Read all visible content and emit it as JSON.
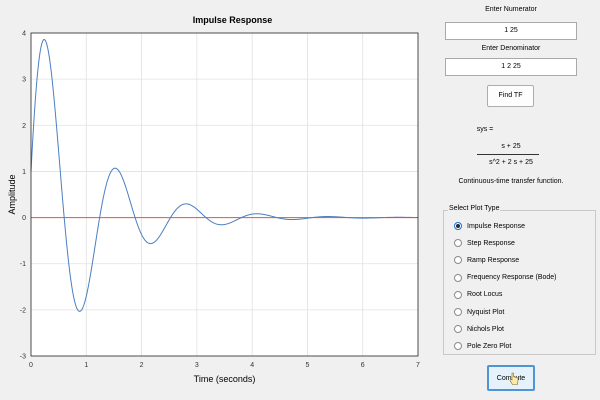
{
  "controls": {
    "numerator_label": "Enter Numerator",
    "numerator_value": "1 25",
    "denominator_label": "Enter Denominator",
    "denominator_value": "1 2 25",
    "find_tf_label": "Find TF",
    "compute_label": "Compute"
  },
  "tf_display": {
    "sys_label": "sys =",
    "numerator": "s + 25",
    "denominator": "s^2 + 2 s + 25",
    "description": "Continuous-time transfer function."
  },
  "plot_type": {
    "title": "Select Plot Type",
    "selected_index": 0,
    "options": [
      {
        "label": "Impulse Response"
      },
      {
        "label": "Step Response"
      },
      {
        "label": "Ramp Response"
      },
      {
        "label": "Frequency Response (Bode)"
      },
      {
        "label": "Root Locus"
      },
      {
        "label": "Nyquist Plot"
      },
      {
        "label": "Nichols Plot"
      },
      {
        "label": "Pole Zero Plot"
      }
    ]
  },
  "chart_data": {
    "type": "line",
    "title": "Impulse Response",
    "xlabel": "Time (seconds)",
    "ylabel": "Amplitude",
    "xlim": [
      0,
      7
    ],
    "ylim": [
      -3,
      4
    ],
    "xticks": [
      0,
      1,
      2,
      3,
      4,
      5,
      6,
      7
    ],
    "yticks": [
      -3,
      -2,
      -1,
      0,
      1,
      2,
      3,
      4
    ],
    "grid": true,
    "colors": {
      "series": "#4a7fc1",
      "zero_line": "#e35a3c"
    },
    "series": [
      {
        "function": "impulse response of (s+25)/(s^2+2s+25)",
        "numerator": [
          1,
          25
        ],
        "denominator": [
          1,
          2,
          25
        ],
        "t_range": [
          0,
          7
        ],
        "peak_points": [
          [
            0.22,
            3.85
          ],
          [
            0.87,
            -2.03
          ],
          [
            1.52,
            1.07
          ],
          [
            2.15,
            -0.55
          ],
          [
            2.8,
            0.31
          ],
          [
            3.4,
            -0.16
          ],
          [
            4.08,
            0.09
          ]
        ]
      }
    ],
    "reference_lines": [
      {
        "y": 0
      }
    ]
  }
}
